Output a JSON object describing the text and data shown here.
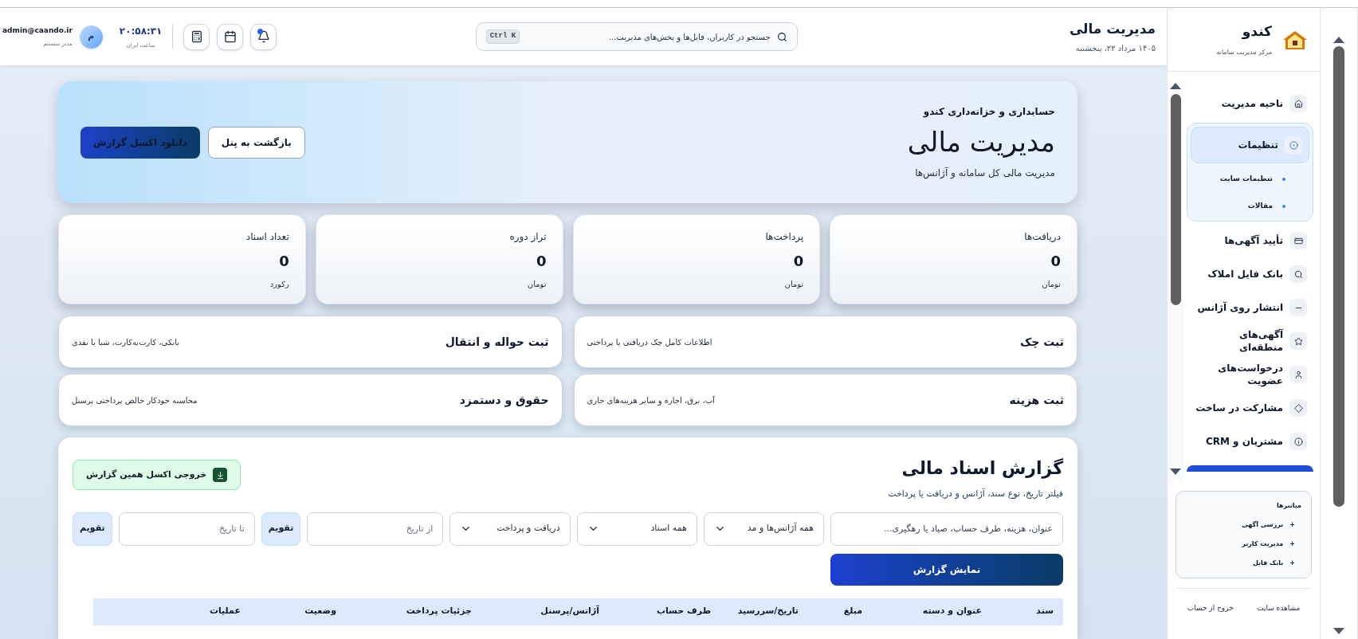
{
  "header": {
    "title": "مدیریت مالی",
    "date": "۱۴۰۵ مرداد ۲۲، پنجشنبه",
    "search": {
      "placeholder": "جستجو در کاربران، فایل‌ها و بخش‌های مدیریت...",
      "shortcut": "Ctrl K"
    },
    "actions": [
      {
        "kind": "bell",
        "badge": true
      },
      {
        "kind": "calendar",
        "badge": false
      },
      {
        "kind": "calculator",
        "badge": false
      }
    ],
    "clock": {
      "time": "۲۰:۵۸:۳۱",
      "caption": "ساعت ایران"
    },
    "user": {
      "initial": "م",
      "email": "admin@caando.ir",
      "role": "مدیر سیستم"
    }
  },
  "hero": {
    "eyebrow": "حسابداری و خزانه‌داری کندو",
    "title": "مدیریت مالی",
    "subtitle": "مدیریت مالی کل سامانه و آژانس‌ها",
    "buttons": [
      {
        "label": "بازگشت به پنل",
        "kind": "secondary"
      },
      {
        "label": "دانلود اکسل گزارش",
        "kind": "primary"
      }
    ]
  },
  "stats": [
    {
      "label": "دریافت‌ها",
      "value": "0",
      "unit": "تومان"
    },
    {
      "label": "پرداخت‌ها",
      "value": "0",
      "unit": "تومان"
    },
    {
      "label": "تراز دوره",
      "value": "0",
      "unit": "تومان"
    },
    {
      "label": "تعداد اسناد",
      "value": "0",
      "unit": "رکورد"
    }
  ],
  "quick_actions": [
    {
      "title": "ثبت چک",
      "description": "اطلاعات کامل چک دریافتی یا پرداختی"
    },
    {
      "title": "ثبت حواله و انتقال",
      "description": "بانکی، کارت‌به‌کارت، شبا یا نقدی"
    },
    {
      "title": "ثبت هزینه",
      "description": "آب، برق، اجاره و سایر هزینه‌های جاری"
    },
    {
      "title": "حقوق و دستمزد",
      "description": "محاسبه خودکار خالص پرداختی پرسنل"
    }
  ],
  "report": {
    "title": "گزارش اسناد مالی",
    "subtitle": "فیلتر تاریخ، نوع سند، آژانس و دریافت یا پرداخت",
    "export_button": "خروجی اکسل همین گزارش",
    "filters": [
      {
        "kind": "search",
        "placeholder": "عنوان، هزینه، طرف حساب، صیاد یا رهگیری..."
      },
      {
        "kind": "select",
        "value": "همه آژانس‌ها و مد"
      },
      {
        "kind": "select",
        "value": "همه اسناد"
      },
      {
        "kind": "select",
        "value": "دریافت و پرداخت"
      },
      {
        "kind": "date",
        "placeholder": "از تاریخ"
      },
      {
        "kind": "calendar",
        "label": "تقویم"
      },
      {
        "kind": "date",
        "placeholder": "تا تاریخ"
      },
      {
        "kind": "calendar",
        "label": "تقویم"
      }
    ],
    "submit": "نمایش گزارش",
    "columns": [
      "سند",
      "عنوان و دسته",
      "مبلغ",
      "تاریخ/سررسید",
      "طرف حساب",
      "آژانس/پرسنل",
      "جزئیات پرداخت",
      "وضعیت",
      "عملیات"
    ]
  },
  "sidebar": {
    "brand": "کندو",
    "tagline": "مرکز مدیریت سامانه",
    "items": [
      {
        "label": "ناحیه مدیریت",
        "selected": false
      },
      {
        "label": "تنظیمات",
        "selected": true,
        "children": [
          "تنظیمات سایت",
          "مقالات"
        ]
      },
      {
        "label": "تأیید آگهی‌ها",
        "selected": false
      },
      {
        "label": "بانک فایل املاک",
        "selected": false
      },
      {
        "label": "انتشار روی آژانس",
        "selected": false
      },
      {
        "label": "آگهی‌های منطقه‌ای",
        "selected": false
      },
      {
        "label": "درخواست‌های عضویت",
        "selected": false
      },
      {
        "label": "مشارکت در ساخت",
        "selected": false
      },
      {
        "label": "مشتریان و CRM",
        "selected": false
      }
    ],
    "shortcuts": {
      "title": "میانبرها",
      "items": [
        {
          "mark": "+",
          "label": "بررسی آگهی"
        },
        {
          "mark": "+",
          "label": "مدیریت کاربر"
        },
        {
          "mark": "+",
          "label": "بانک فایل"
        }
      ]
    },
    "footer": [
      "مشاهده سایت",
      "خروج از حساب"
    ]
  }
}
